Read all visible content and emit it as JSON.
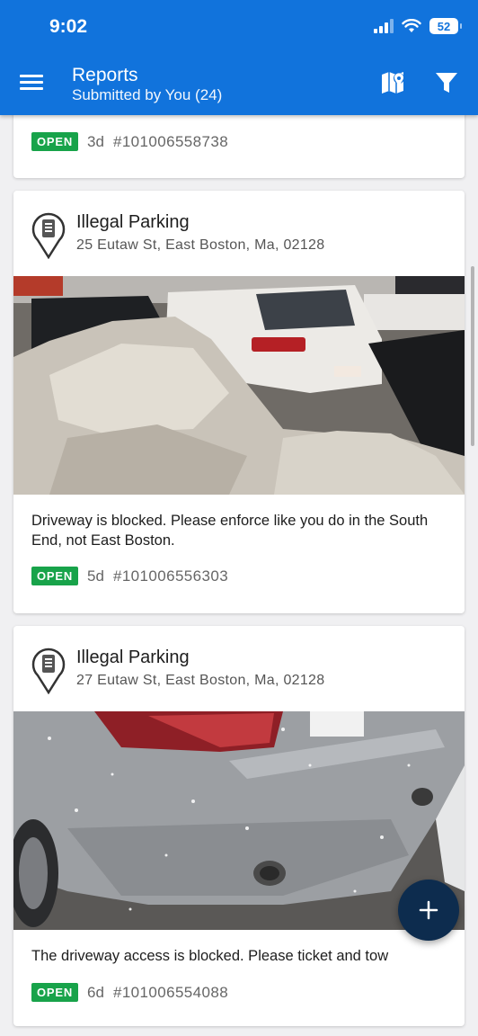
{
  "status": {
    "time": "9:02",
    "battery": "52"
  },
  "header": {
    "title": "Reports",
    "subtitle": "Submitted by You (24)"
  },
  "colors": {
    "appbar": "#1173dc",
    "open_badge": "#18a34a",
    "fab": "#0d2c4e"
  },
  "reports": [
    {
      "status": "OPEN",
      "age": "3d",
      "id": "#101006558738"
    },
    {
      "title": "Illegal Parking",
      "address": "25 Eutaw St, East Boston, Ma, 02128",
      "photo": "white car parked behind large snow pile",
      "description": "Driveway is blocked. Please enforce like you do in the South End, not East Boston.",
      "status": "OPEN",
      "age": "5d",
      "id": "#101006556303"
    },
    {
      "title": "Illegal Parking",
      "address": "27 Eutaw St, East Boston, Ma, 02128",
      "photo": "rear of silver car in falling snow",
      "description": "The driveway access is blocked. Please ticket and tow",
      "status": "OPEN",
      "age": "6d",
      "id": "#101006554088"
    }
  ],
  "fab": {
    "icon": "plus-icon"
  }
}
